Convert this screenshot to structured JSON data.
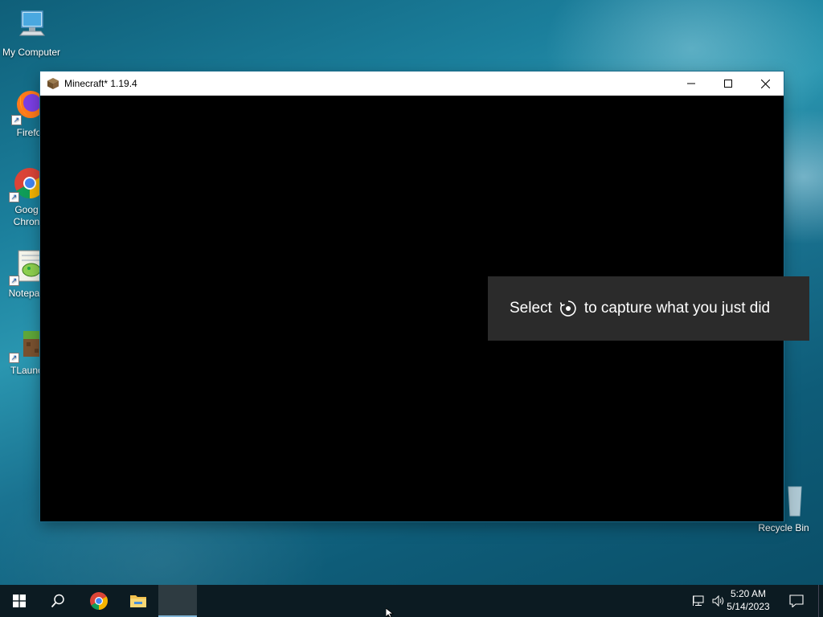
{
  "desktop": {
    "icons": [
      {
        "label": "My Computer"
      },
      {
        "label": "Firefo"
      },
      {
        "label": "Goog Chron",
        "label_line1": "Goog",
        "label_line2": "Chron"
      },
      {
        "label": "Notepac"
      },
      {
        "label": "TLaunc"
      },
      {
        "label": "Recycle Bin"
      }
    ]
  },
  "window": {
    "title": "Minecraft* 1.19.4",
    "buttons": {
      "minimize": "minimize-icon",
      "maximize": "maximize-icon",
      "close": "close-icon"
    }
  },
  "toast": {
    "text_before": "Select",
    "icon": "capture-icon",
    "text_after": "to capture what you just did"
  },
  "taskbar": {
    "items": [
      "start-icon",
      "search-icon",
      "chrome-icon",
      "file-explorer-icon",
      "minecraft-task"
    ],
    "clock": {
      "time": "5:20 AM",
      "date": "5/14/2023"
    }
  },
  "colors": {
    "taskbar_bg": "#0c1b22",
    "toast_bg": "#2b2b2b",
    "window_client": "#000000"
  }
}
